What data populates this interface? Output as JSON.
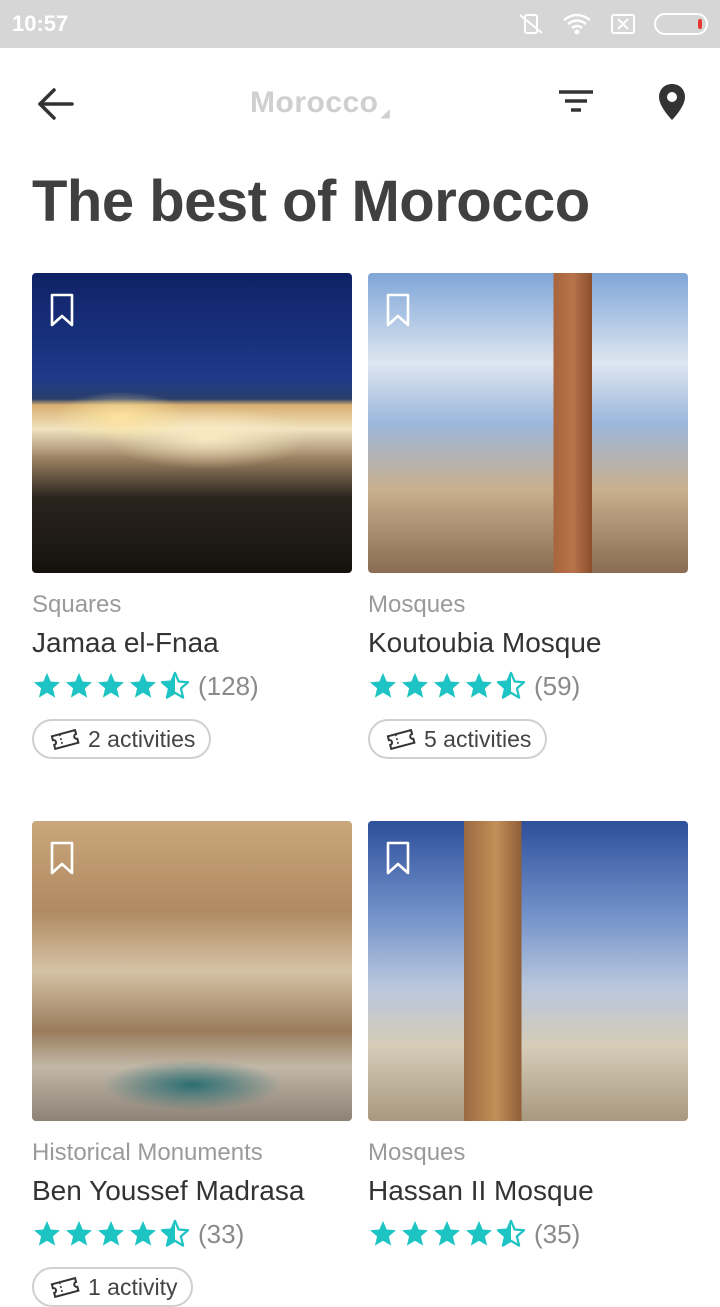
{
  "status": {
    "time": "10:57"
  },
  "appbar": {
    "title": "Morocco"
  },
  "heading": "The best of Morocco",
  "colors": {
    "star": "#1ec3c3",
    "accent": "#1ec3c3"
  },
  "places": [
    {
      "category": "Squares",
      "name": "Jamaa el-Fnaa",
      "rating": 4.5,
      "reviews": "(128)",
      "activities": "2 activities"
    },
    {
      "category": "Mosques",
      "name": "Koutoubia Mosque",
      "rating": 4.5,
      "reviews": "(59)",
      "activities": "5 activities"
    },
    {
      "category": "Historical Monuments",
      "name": "Ben Youssef Madrasa",
      "rating": 4.5,
      "reviews": "(33)",
      "activities": "1 activity"
    },
    {
      "category": "Mosques",
      "name": "Hassan II Mosque",
      "rating": 4.5,
      "reviews": "(35)",
      "activities": ""
    }
  ]
}
